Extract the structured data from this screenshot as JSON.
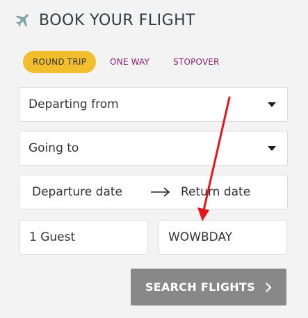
{
  "header": {
    "icon": "plane-icon",
    "title": "BOOK YOUR FLIGHT"
  },
  "trip_types": [
    {
      "label": "ROUND TRIP",
      "selected": true
    },
    {
      "label": "ONE WAY",
      "selected": false
    },
    {
      "label": "STOPOVER",
      "selected": false
    }
  ],
  "form": {
    "departing_from": "Departing from",
    "going_to": "Going to",
    "departure_date": "Departure date",
    "return_date": "Return date",
    "guests": "1 Guest",
    "promo_code": "WOWBDAY"
  },
  "search_button": {
    "label": "SEARCH FLIGHTS"
  },
  "colors": {
    "accent_yellow": "#f2be2e",
    "tab_text": "#8b1f6e",
    "button_gray": "#888888",
    "annotation_red": "#e8141c",
    "plane_teal": "#7fa3a3"
  }
}
